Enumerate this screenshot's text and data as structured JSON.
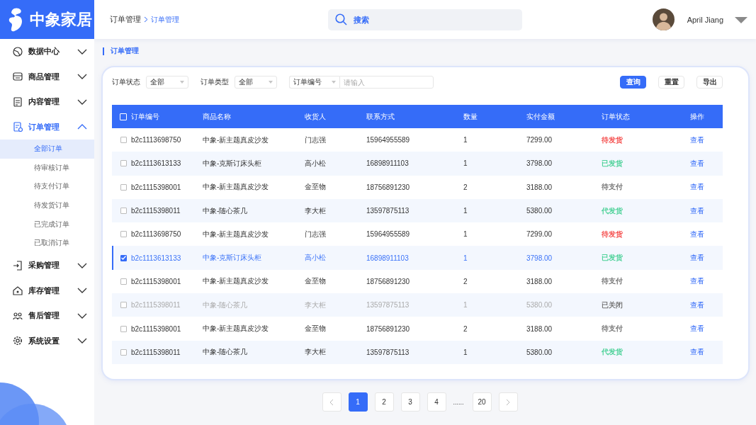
{
  "logo": {
    "text": "中象家居"
  },
  "sidebar": {
    "items": [
      {
        "label": "数据中心",
        "expanded": false,
        "selected": false
      },
      {
        "label": "商品管理",
        "expanded": false,
        "selected": false
      },
      {
        "label": "内容管理",
        "expanded": false,
        "selected": false
      },
      {
        "label": "订单管理",
        "expanded": true,
        "selected": true,
        "children": [
          {
            "label": "全部订单",
            "selected": true
          },
          {
            "label": "待审核订单",
            "selected": false
          },
          {
            "label": "待支付订单",
            "selected": false
          },
          {
            "label": "待发货订单",
            "selected": false
          },
          {
            "label": "已完成订单",
            "selected": false
          },
          {
            "label": "已取消订单",
            "selected": false
          }
        ]
      },
      {
        "label": "采购管理",
        "expanded": false,
        "selected": false
      },
      {
        "label": "库存管理",
        "expanded": false,
        "selected": false
      },
      {
        "label": "售后管理",
        "expanded": false,
        "selected": false
      },
      {
        "label": "系统设置",
        "expanded": false,
        "selected": false
      }
    ]
  },
  "breadcrumb": [
    "订单管理",
    "订单管理"
  ],
  "search": {
    "placeholder": "搜索"
  },
  "user": {
    "name": "April Jiang"
  },
  "page_title": "订单管理",
  "filters": {
    "status": {
      "label": "订单状态",
      "value": "全部"
    },
    "type": {
      "label": "订单类型",
      "value": "全部"
    },
    "field": {
      "value": "订单编号",
      "placeholder": "请输入"
    }
  },
  "buttons": [
    {
      "label": "查询",
      "primary": true
    },
    {
      "label": "重置",
      "primary": false
    },
    {
      "label": "导出",
      "primary": false
    }
  ],
  "table": {
    "header_checked": false,
    "columns": [
      "订单编号",
      "商品名称",
      "收货人",
      "联系方式",
      "数量",
      "实付金额",
      "订单状态",
      "操作"
    ],
    "rows": [
      {
        "checked": false,
        "selected": false,
        "disabled": false,
        "cells": [
          "b2c1113698750",
          "中象-新主题真皮沙发",
          "门志强",
          "15964955589",
          "1",
          "7299.00"
        ],
        "status": {
          "text": "待发货",
          "color": "#f5504f"
        },
        "action": "查看"
      },
      {
        "checked": false,
        "selected": false,
        "disabled": false,
        "cells": [
          "b2c1113613133",
          "中象-克斯订床头柜",
          "高小松",
          "16898911103",
          "1",
          "3798.00"
        ],
        "status": {
          "text": "已发货",
          "color": "#4fd29a"
        },
        "action": "查看"
      },
      {
        "checked": false,
        "selected": false,
        "disabled": false,
        "cells": [
          "b2c1115398001",
          "中象-新主题真皮沙发",
          "金至物",
          "18756891230",
          "2",
          "3188.00"
        ],
        "status": {
          "text": "待支付",
          "color": "#777777"
        },
        "action": "查看"
      },
      {
        "checked": false,
        "selected": false,
        "disabled": false,
        "cells": [
          "b2c1115398011",
          "中象-随心茶几",
          "李大柜",
          "13597875113",
          "1",
          "5380.00"
        ],
        "status": {
          "text": "代发货",
          "color": "#4fd29a"
        },
        "action": "查看"
      },
      {
        "checked": false,
        "selected": false,
        "disabled": false,
        "cells": [
          "b2c1113698750",
          "中象-新主题真皮沙发",
          "门志强",
          "15964955589",
          "1",
          "7299.00"
        ],
        "status": {
          "text": "待发货",
          "color": "#f5504f"
        },
        "action": "查看"
      },
      {
        "checked": true,
        "selected": true,
        "disabled": false,
        "cells": [
          "b2c1113613133",
          "中象-克斯订床头柜",
          "高小松",
          "16898911103",
          "1",
          "3798.00"
        ],
        "status": {
          "text": "已发货",
          "color": "#4fd29a"
        },
        "action": "查看"
      },
      {
        "checked": false,
        "selected": false,
        "disabled": false,
        "cells": [
          "b2c1115398001",
          "中象-新主题真皮沙发",
          "金至物",
          "18756891230",
          "2",
          "3188.00"
        ],
        "status": {
          "text": "待支付",
          "color": "#777777"
        },
        "action": "查看"
      },
      {
        "checked": false,
        "selected": false,
        "disabled": true,
        "cells": [
          "b2c1115398011",
          "中象-随心茶几",
          "李大柜",
          "13597875113",
          "1",
          "5380.00"
        ],
        "status": {
          "text": "已关闭",
          "color": "#777777"
        },
        "action": "查看"
      },
      {
        "checked": false,
        "selected": false,
        "disabled": false,
        "cells": [
          "b2c1115398001",
          "中象-新主题真皮沙发",
          "金至物",
          "18756891230",
          "2",
          "3188.00"
        ],
        "status": {
          "text": "待支付",
          "color": "#777777"
        },
        "action": "查看"
      },
      {
        "checked": false,
        "selected": false,
        "disabled": false,
        "cells": [
          "b2c1115398011",
          "中象-随心茶几",
          "李大柜",
          "13597875113",
          "1",
          "5380.00"
        ],
        "status": {
          "text": "代发货",
          "color": "#4fd29a"
        },
        "action": "查看"
      }
    ]
  },
  "pagination": {
    "pages": [
      {
        "label": "1",
        "selected": true,
        "kind": "page"
      },
      {
        "label": "2",
        "selected": false,
        "kind": "page"
      },
      {
        "label": "3",
        "selected": false,
        "kind": "page"
      },
      {
        "label": "4",
        "selected": false,
        "kind": "page"
      },
      {
        "label": "......",
        "kind": "ellipsis"
      },
      {
        "label": "20",
        "selected": false,
        "kind": "page"
      }
    ]
  }
}
